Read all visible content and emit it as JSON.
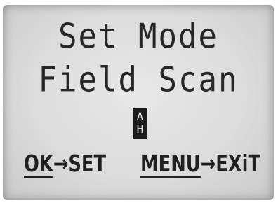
{
  "screen": {
    "title": "Set Mode",
    "mode_value": "Field Scan",
    "cursor_top": "A",
    "cursor_bottom": "H"
  },
  "hints": {
    "ok_key": "OK",
    "ok_action": "→SET",
    "menu_key": "MENU",
    "menu_action": "→EXiT"
  }
}
